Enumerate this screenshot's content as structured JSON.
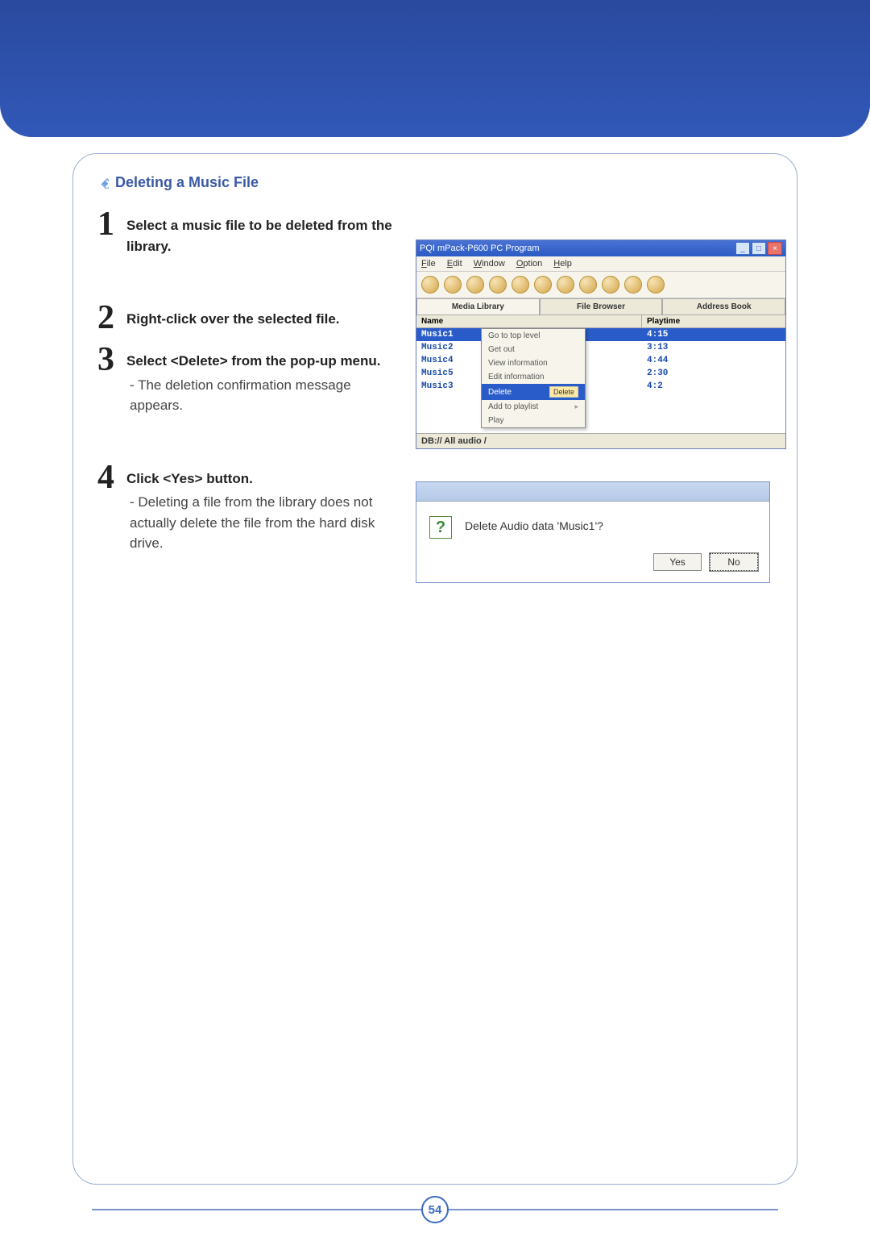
{
  "section_title": "Deleting a Music File",
  "steps": [
    {
      "num": "1",
      "text": "Select a music file to be deleted from the library."
    },
    {
      "num": "2",
      "text": "Right-click over the selected file."
    },
    {
      "num": "3",
      "text": "Select <Delete> from the pop-up menu.",
      "sub": "- The deletion confirmation message appears."
    },
    {
      "num": "4",
      "text": "Click <Yes> button.",
      "sub": "- Deleting a file from the library does not actually delete the file from the hard disk drive."
    }
  ],
  "app": {
    "title": "PQI mPack-P600 PC Program",
    "menus": [
      "File",
      "Edit",
      "Window",
      "Option",
      "Help"
    ],
    "tabs": [
      "Media Library",
      "File Browser",
      "Address Book"
    ],
    "columns": {
      "name": "Name",
      "playtime": "Playtime"
    },
    "rows": [
      {
        "name": "Music1",
        "playtime": "4:15",
        "selected": true
      },
      {
        "name": "Music2",
        "playtime": "3:13"
      },
      {
        "name": "Music4",
        "playtime": "4:44"
      },
      {
        "name": "Music5",
        "playtime": "2:30"
      },
      {
        "name": "Music3",
        "playtime": "4:2"
      }
    ],
    "context_menu": [
      "Go to top level",
      "Get out",
      "View information",
      "Edit information",
      "Delete",
      "Add to playlist",
      "Play"
    ],
    "context_hint": "Delete",
    "status": "DB:// All audio /"
  },
  "dialog": {
    "message": "Delete Audio data 'Music1'?",
    "yes": "Yes",
    "no": "No"
  },
  "page_number": "54"
}
